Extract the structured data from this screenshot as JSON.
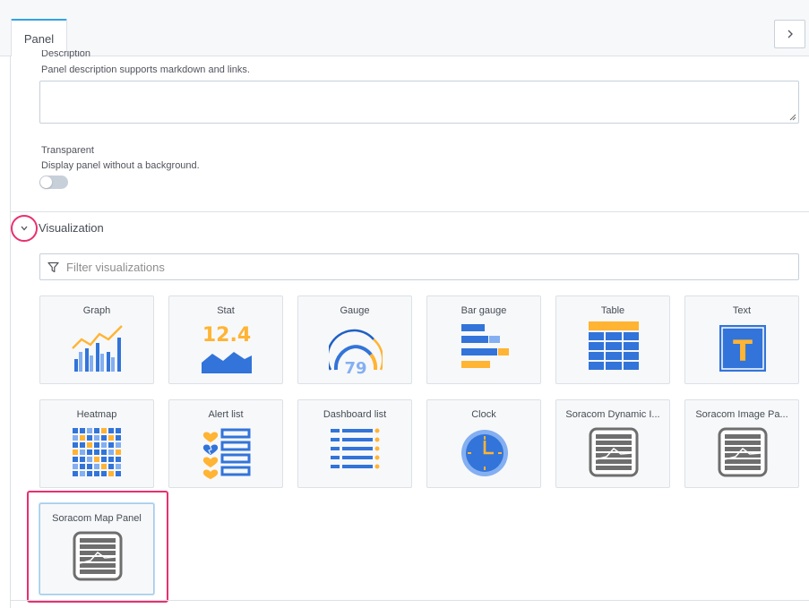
{
  "header": {
    "tab_panel": "Panel",
    "expand_icon": "chevron-right-icon"
  },
  "description": {
    "label": "Description",
    "hint": "Panel description supports markdown and links.",
    "value": ""
  },
  "transparent": {
    "label": "Transparent",
    "hint": "Display panel without a background.",
    "enabled": false
  },
  "visualization": {
    "title": "Visualization",
    "collapse_icon": "chevron-down-icon",
    "filter_placeholder": "Filter visualizations",
    "items": [
      {
        "label": "Graph",
        "icon": "graph-icon"
      },
      {
        "label": "Stat",
        "icon": "stat-icon"
      },
      {
        "label": "Gauge",
        "icon": "gauge-icon"
      },
      {
        "label": "Bar gauge",
        "icon": "bar-gauge-icon"
      },
      {
        "label": "Table",
        "icon": "table-icon"
      },
      {
        "label": "Text",
        "icon": "text-icon"
      },
      {
        "label": "Heatmap",
        "icon": "heatmap-icon"
      },
      {
        "label": "Alert list",
        "icon": "alert-list-icon"
      },
      {
        "label": "Dashboard list",
        "icon": "dashboard-list-icon"
      },
      {
        "label": "Clock",
        "icon": "clock-icon"
      },
      {
        "label": "Soracom Dynamic I...",
        "icon": "plugin-panel-icon"
      },
      {
        "label": "Soracom Image Pa...",
        "icon": "plugin-panel-icon"
      },
      {
        "label": "Soracom Map Panel",
        "icon": "plugin-panel-icon"
      }
    ],
    "stat_value": "12.4",
    "gauge_value": "79",
    "text_letter": "T"
  },
  "colors": {
    "accent_blue": "#3274d9",
    "accent_orange": "#ffb433",
    "highlight": "#e8306f",
    "tab_active": "#33a2e5"
  }
}
